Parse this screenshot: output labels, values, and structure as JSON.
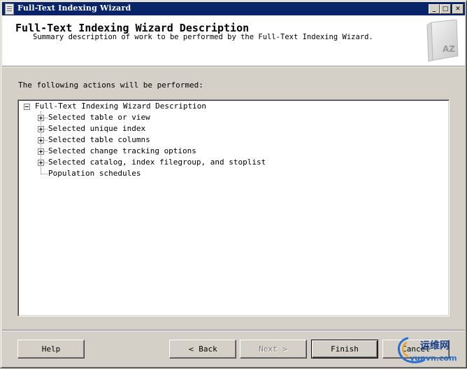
{
  "window": {
    "title": "Full-Text Indexing Wizard",
    "controls": {
      "minimize": "_",
      "maximize": "□",
      "close": "✕"
    }
  },
  "header": {
    "title": "Full-Text Indexing Wizard Description",
    "subtitle": "Summary description of work to be performed by the Full-Text Indexing Wizard.",
    "icon": "book-az-icon",
    "icon_text": "AZ"
  },
  "main": {
    "prompt": "The following actions will be performed:",
    "tree": {
      "root": "Full-Text Indexing Wizard Description",
      "items": [
        {
          "label": "Selected table or view",
          "expandable": true
        },
        {
          "label": "Selected unique index",
          "expandable": true
        },
        {
          "label": "Selected table columns",
          "expandable": true
        },
        {
          "label": "Selected change tracking options",
          "expandable": true
        },
        {
          "label": "Selected catalog, index filegroup, and stoplist",
          "expandable": true
        },
        {
          "label": "Population schedules",
          "expandable": false
        }
      ]
    }
  },
  "buttons": {
    "help": "Help",
    "back": "Back",
    "back_arrow": "<",
    "next": "Next",
    "next_arrow": ">",
    "finish": "Finish",
    "cancel": "Cancel"
  },
  "watermark": {
    "line1": "运维网",
    "line2": "yunvn.com"
  },
  "colors": {
    "titlebar": "#0a246a",
    "face": "#d4d0c8",
    "header_bg": "#ffffff"
  }
}
